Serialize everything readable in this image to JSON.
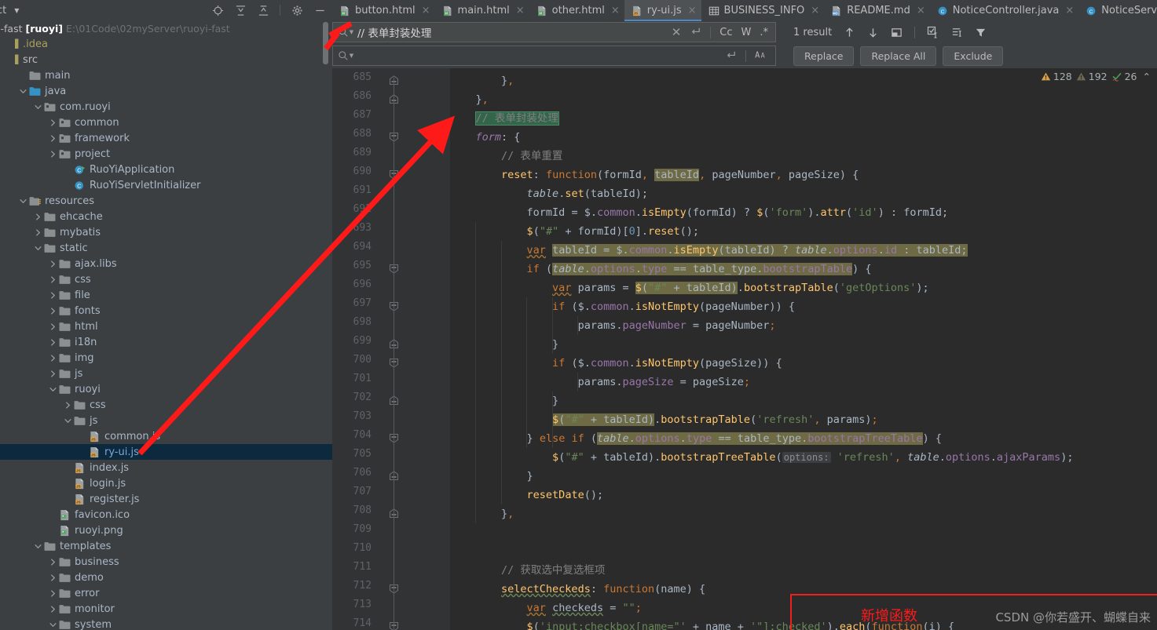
{
  "project_panel": {
    "title": "ect",
    "project_name": "oyi-fast",
    "project_module": "[ruoyi]",
    "project_path": "E:\\01Code\\02myServer\\ruoyi-fast",
    "tools": [
      "locate-icon",
      "expand-all-icon",
      "collapse-all-icon",
      "gear-icon",
      "minimize-icon"
    ],
    "tree": [
      {
        "label": ".idea",
        "depth": 0,
        "icon": "module-bar",
        "arrow": "none",
        "kind": "idea"
      },
      {
        "label": "src",
        "depth": 0,
        "icon": "module-bar",
        "arrow": "none",
        "kind": "module"
      },
      {
        "label": "main",
        "depth": 1,
        "icon": "folder",
        "arrow": "none",
        "kind": "plain"
      },
      {
        "label": "java",
        "depth": 1,
        "icon": "source-folder",
        "arrow": "down",
        "kind": "plain"
      },
      {
        "label": "com.ruoyi",
        "depth": 2,
        "icon": "package",
        "arrow": "down",
        "kind": "plain"
      },
      {
        "label": "common",
        "depth": 3,
        "icon": "package",
        "arrow": "right",
        "kind": "plain"
      },
      {
        "label": "framework",
        "depth": 3,
        "icon": "package",
        "arrow": "right",
        "kind": "plain"
      },
      {
        "label": "project",
        "depth": 3,
        "icon": "package",
        "arrow": "right",
        "kind": "plain"
      },
      {
        "label": "RuoYiApplication",
        "depth": 4,
        "icon": "class-run",
        "arrow": "none",
        "kind": "plain"
      },
      {
        "label": "RuoYiServletInitializer",
        "depth": 4,
        "icon": "class",
        "arrow": "none",
        "kind": "plain"
      },
      {
        "label": "resources",
        "depth": 1,
        "icon": "resource-folder",
        "arrow": "down",
        "kind": "plain"
      },
      {
        "label": "ehcache",
        "depth": 2,
        "icon": "folder",
        "arrow": "right",
        "kind": "plain"
      },
      {
        "label": "mybatis",
        "depth": 2,
        "icon": "folder",
        "arrow": "right",
        "kind": "plain"
      },
      {
        "label": "static",
        "depth": 2,
        "icon": "folder",
        "arrow": "down",
        "kind": "plain"
      },
      {
        "label": "ajax.libs",
        "depth": 3,
        "icon": "folder",
        "arrow": "right",
        "kind": "plain"
      },
      {
        "label": "css",
        "depth": 3,
        "icon": "folder",
        "arrow": "right",
        "kind": "plain"
      },
      {
        "label": "file",
        "depth": 3,
        "icon": "folder",
        "arrow": "right",
        "kind": "plain"
      },
      {
        "label": "fonts",
        "depth": 3,
        "icon": "folder",
        "arrow": "right",
        "kind": "plain"
      },
      {
        "label": "html",
        "depth": 3,
        "icon": "folder",
        "arrow": "right",
        "kind": "plain"
      },
      {
        "label": "i18n",
        "depth": 3,
        "icon": "folder",
        "arrow": "right",
        "kind": "plain"
      },
      {
        "label": "img",
        "depth": 3,
        "icon": "folder",
        "arrow": "right",
        "kind": "plain"
      },
      {
        "label": "js",
        "depth": 3,
        "icon": "folder",
        "arrow": "right",
        "kind": "plain"
      },
      {
        "label": "ruoyi",
        "depth": 3,
        "icon": "folder",
        "arrow": "down",
        "kind": "plain"
      },
      {
        "label": "css",
        "depth": 4,
        "icon": "folder",
        "arrow": "right",
        "kind": "plain"
      },
      {
        "label": "js",
        "depth": 4,
        "icon": "folder",
        "arrow": "down",
        "kind": "plain"
      },
      {
        "label": "common.js",
        "depth": 5,
        "icon": "js-file",
        "arrow": "none",
        "kind": "plain"
      },
      {
        "label": "ry-ui.js",
        "depth": 5,
        "icon": "js-file",
        "arrow": "none",
        "kind": "selected"
      },
      {
        "label": "index.js",
        "depth": 4,
        "icon": "js-file",
        "arrow": "none",
        "kind": "plain"
      },
      {
        "label": "login.js",
        "depth": 4,
        "icon": "js-file",
        "arrow": "none",
        "kind": "plain"
      },
      {
        "label": "register.js",
        "depth": 4,
        "icon": "js-file",
        "arrow": "none",
        "kind": "plain"
      },
      {
        "label": "favicon.ico",
        "depth": 3,
        "icon": "image-file",
        "arrow": "none",
        "kind": "plain"
      },
      {
        "label": "ruoyi.png",
        "depth": 3,
        "icon": "image-file",
        "arrow": "none",
        "kind": "plain"
      },
      {
        "label": "templates",
        "depth": 2,
        "icon": "folder",
        "arrow": "down",
        "kind": "plain"
      },
      {
        "label": "business",
        "depth": 3,
        "icon": "folder",
        "arrow": "right",
        "kind": "plain"
      },
      {
        "label": "demo",
        "depth": 3,
        "icon": "folder",
        "arrow": "right",
        "kind": "plain"
      },
      {
        "label": "error",
        "depth": 3,
        "icon": "folder",
        "arrow": "right",
        "kind": "plain"
      },
      {
        "label": "monitor",
        "depth": 3,
        "icon": "folder",
        "arrow": "right",
        "kind": "plain"
      },
      {
        "label": "system",
        "depth": 3,
        "icon": "folder",
        "arrow": "down",
        "kind": "plain"
      }
    ]
  },
  "tabs": {
    "items": [
      {
        "label": "button.html",
        "icon": "html-file-icon",
        "active": false
      },
      {
        "label": "main.html",
        "icon": "html-file-icon",
        "active": false
      },
      {
        "label": "other.html",
        "icon": "html-file-icon",
        "active": false
      },
      {
        "label": "ry-ui.js",
        "icon": "js-file-icon",
        "active": true
      },
      {
        "label": "BUSINESS_INFO",
        "icon": "table-icon",
        "active": false
      },
      {
        "label": "README.md",
        "icon": "md-file-icon",
        "active": false
      },
      {
        "label": "NoticeController.java",
        "icon": "java-class-icon",
        "active": false
      },
      {
        "label": "NoticeServiceImpl.java",
        "icon": "java-class-icon",
        "active": false
      }
    ],
    "overflow_label": "⌄",
    "close_glyph": "×"
  },
  "find_replace": {
    "find_value": "// 表单封装处理",
    "replace_value": "",
    "result_count": "1 result",
    "options": {
      "case": "Cc",
      "word": "W",
      "regex": ".*"
    },
    "buttons": {
      "replace": "Replace",
      "replace_all": "Replace All",
      "exclude": "Exclude"
    },
    "icons": [
      "search-icon",
      "close-icon",
      "multiline-icon",
      "preserve-case-icon",
      "select-all-icon",
      "filter-icon",
      "in-selection-icon"
    ]
  },
  "editor": {
    "inspections": {
      "warning_count": "128",
      "weak_warning_count": "192",
      "typo_count": "26",
      "collapse_glyph": "⌃"
    },
    "first_line": 685,
    "lines": [
      {
        "n": 685,
        "indent": 0,
        "fold": "end",
        "html": "        <span class='id'>}</span><span class='kw'>,</span>"
      },
      {
        "n": 686,
        "indent": 0,
        "fold": "end",
        "html": "    <span class='id'>}</span><span class='kw'>,</span>"
      },
      {
        "n": 687,
        "indent": 0,
        "fold": "none",
        "html": "    <span class='cmt hl'>// 表单封装处理</span>"
      },
      {
        "n": 688,
        "indent": 0,
        "fold": "start",
        "html": "    <span class='itp'>form</span><span class='id'>: {</span>"
      },
      {
        "n": 689,
        "indent": 0,
        "fold": "none",
        "html": "        <span class='cmt'>// 表单重置</span>"
      },
      {
        "n": 690,
        "indent": 0,
        "fold": "start",
        "html": "        <span class='fn'>reset</span><span class='id'>: </span><span class='kw'>function</span><span class='id'>(</span><span class='id'>formId</span><span class='kw'>, </span><span class='id occ'>tableId</span><span class='kw'>, </span><span class='id'>pageNumber</span><span class='kw'>, </span><span class='id'>pageSize</span><span class='id'>) {</span>"
      },
      {
        "n": 691,
        "indent": 0,
        "fold": "none",
        "html": "            <span class='it'>table</span><span class='id'>.</span><span class='fn'>set</span><span class='id'>(tableId);</span>"
      },
      {
        "n": 692,
        "indent": 0,
        "fold": "none",
        "html": "            <span class='id'>formId = $.</span><span class='prop'>common</span><span class='id'>.</span><span class='fn'>isEmpty</span><span class='id'>(formId) ? </span><span class='fn'>$</span><span class='id'>(</span><span class='str'>'form'</span><span class='id'>).</span><span class='fn'>attr</span><span class='id'>(</span><span class='str'>'id'</span><span class='id'>) : formId;</span>"
      },
      {
        "n": 693,
        "indent": 0,
        "fold": "none",
        "html": "            <span class='fn'>$</span><span class='id'>(</span><span class='str'>\"#\"</span><span class='id'> + formId)[</span><span class='num'>0</span><span class='id'>].</span><span class='fn'>reset</span><span class='id'>();</span>"
      },
      {
        "n": 694,
        "indent": 0,
        "fold": "none",
        "html": "            <span class='kw sqo'>var</span><span class='id'> </span><span class='id occ'>tableId</span><span class='id occ'> = $.</span><span class='prop occ'>common</span><span class='id occ'>.</span><span class='fn occ'>isEmpty</span><span class='id occ'>(tableId) ? </span><span class='it occ'>table</span><span class='id occ'>.</span><span class='prop occ'>options</span><span class='id occ'>.</span><span class='prop occ'>id</span><span class='id occ'> : tableId;</span>"
      },
      {
        "n": 695,
        "indent": 0,
        "fold": "start",
        "html": "            <span class='kw'>if </span><span class='id'>(</span><span class='it occ'>table</span><span class='id occ'>.</span><span class='prop occ'>options</span><span class='id occ'>.</span><span class='prop occ'>type</span><span class='id occ'> == </span><span class='id occ'>table_type</span><span class='id occ'>.</span><span class='prop occ'>bootstrapTable</span><span class='id'>) {</span>"
      },
      {
        "n": 696,
        "indent": 0,
        "fold": "none",
        "html": "                <span class='kw sqo'>var</span><span class='id'> params = </span><span class='fn occ'>$</span><span class='id occ'>(</span><span class='str occ'>\"#\"</span><span class='id occ'> + tableId)</span><span class='id'>.</span><span class='fn'>bootstrapTable</span><span class='id'>(</span><span class='str'>'getOptions'</span><span class='id'>);</span>"
      },
      {
        "n": 697,
        "indent": 0,
        "fold": "start",
        "html": "                <span class='kw'>if </span><span class='id'>($.</span><span class='prop'>common</span><span class='id'>.</span><span class='fn'>isNotEmpty</span><span class='id'>(pageNumber)) {</span>"
      },
      {
        "n": 698,
        "indent": 0,
        "fold": "none",
        "html": "                    <span class='id'>params.</span><span class='prop'>pageNumber</span><span class='id'> = pageNumber</span><span class='kw'>;</span>"
      },
      {
        "n": 699,
        "indent": 0,
        "fold": "end",
        "html": "                <span class='id'>}</span>"
      },
      {
        "n": 700,
        "indent": 0,
        "fold": "start",
        "html": "                <span class='kw'>if </span><span class='id'>($.</span><span class='prop'>common</span><span class='id'>.</span><span class='fn'>isNotEmpty</span><span class='id'>(pageSize)) {</span>"
      },
      {
        "n": 701,
        "indent": 0,
        "fold": "none",
        "html": "                    <span class='id'>params.</span><span class='prop'>pageSize</span><span class='id'> = pageSize</span><span class='kw'>;</span>"
      },
      {
        "n": 702,
        "indent": 0,
        "fold": "end",
        "html": "                <span class='id'>}</span>"
      },
      {
        "n": 703,
        "indent": 0,
        "fold": "none",
        "html": "                <span class='fn occ'>$</span><span class='id occ'>(</span><span class='str occ'>\"#\"</span><span class='id occ'> + tableId)</span><span class='id'>.</span><span class='fn'>bootstrapTable</span><span class='id'>(</span><span class='str'>'refresh'</span><span class='kw'>, </span><span class='id'>params)</span><span class='kw'>;</span>"
      },
      {
        "n": 704,
        "indent": 0,
        "fold": "start",
        "html": "            <span class='id'>} </span><span class='kw'>else if </span><span class='id'>(</span><span class='it occ'>table</span><span class='id occ'>.</span><span class='prop occ'>options</span><span class='id occ'>.</span><span class='prop occ'>type</span><span class='id occ'> == </span><span class='id occ'>table_type</span><span class='id occ'>.</span><span class='prop occ'>bootstrapTreeTable</span><span class='id'>) {</span>"
      },
      {
        "n": 705,
        "indent": 0,
        "fold": "none",
        "html": "                <span class='fn'>$</span><span class='id'>(</span><span class='str'>\"#\"</span><span class='id'> + tableId).</span><span class='fn'>bootstrapTreeTable</span><span class='id'>(</span><span class='hint'>options:</span><span class='id'> </span><span class='str'>'refresh'</span><span class='kw'>, </span><span class='it'>table</span><span class='id'>.</span><span class='prop'>options</span><span class='id'>.</span><span class='prop'>ajaxParams</span><span class='id'>);</span>"
      },
      {
        "n": 706,
        "indent": 0,
        "fold": "end",
        "html": "            <span class='id'>}</span>"
      },
      {
        "n": 707,
        "indent": 0,
        "fold": "none",
        "html": "            <span class='fn'>resetDate</span><span class='id'>();</span>"
      },
      {
        "n": 708,
        "indent": 0,
        "fold": "end",
        "html": "        <span class='id'>}</span><span class='kw'>,</span>"
      },
      {
        "n": 709,
        "indent": 0,
        "fold": "none",
        "html": ""
      },
      {
        "n": 710,
        "indent": 0,
        "fold": "none",
        "html": ""
      },
      {
        "n": 711,
        "indent": 0,
        "fold": "none",
        "html": "        <span class='cmt'>// 获取选中复选框项</span>"
      },
      {
        "n": 712,
        "indent": 0,
        "fold": "start",
        "html": "        <span class='fn sq'>selectCheckeds</span><span class='id'>: </span><span class='kw'>function</span><span class='id'>(name) {</span>"
      },
      {
        "n": 713,
        "indent": 0,
        "fold": "none",
        "html": "            <span class='kw sqo'>var</span><span class='id'> </span><span class='id sq'>checkeds</span><span class='id'> = </span><span class='str'>\"\"</span><span class='kw'>;</span>"
      },
      {
        "n": 714,
        "indent": 0,
        "fold": "start",
        "html": "            <span class='fn'>$</span><span class='id'>(</span><span class='str'>'input:checkbox[name=\"'</span><span class='id'> + name + </span><span class='str'>'\"]:checked'</span><span class='id'>).</span><span class='fn'>each</span><span class='id'>(</span><span class='kw'>function</span><span class='id'>(i) {</span>"
      }
    ]
  },
  "annotation": {
    "box_label": "新增函数",
    "box_color": "#f01f1f",
    "arrow_color": "#ff1a1a"
  },
  "watermark": {
    "text": "CSDN @你若盛开、蝴蝶自来"
  }
}
